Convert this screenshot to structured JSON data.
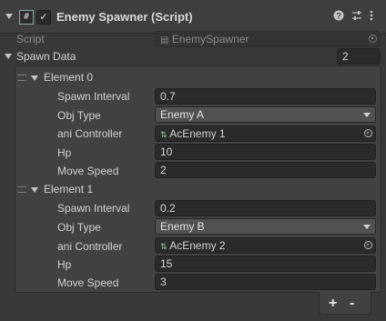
{
  "component": {
    "title": "Enemy Spawner (Script)",
    "script_icon": "#",
    "enabled_check": "✓",
    "icons": [
      "help-icon",
      "settings-sliders-icon",
      "more-options-icon"
    ]
  },
  "script_field": {
    "label": "Script",
    "value": "EnemySpawner"
  },
  "spawn_data": {
    "label": "Spawn Data",
    "size": "2",
    "elements": [
      {
        "label": "Element 0",
        "spawn_interval_label": "Spawn Interval",
        "spawn_interval": "0.7",
        "obj_type_label": "Obj Type",
        "obj_type": "Enemy A",
        "ani_controller_label": "ani Controller",
        "ani_controller": "AcEnemy 1",
        "hp_label": "Hp",
        "hp": "10",
        "move_speed_label": "Move Speed",
        "move_speed": "2"
      },
      {
        "label": "Element 1",
        "spawn_interval_label": "Spawn Interval",
        "spawn_interval": "0.2",
        "obj_type_label": "Obj Type",
        "obj_type": "Enemy B",
        "ani_controller_label": "ani Controller",
        "ani_controller": "AcEnemy 2",
        "hp_label": "Hp",
        "hp": "15",
        "move_speed_label": "Move Speed",
        "move_speed": "3"
      }
    ],
    "add_label": "+",
    "remove_label": "-"
  }
}
